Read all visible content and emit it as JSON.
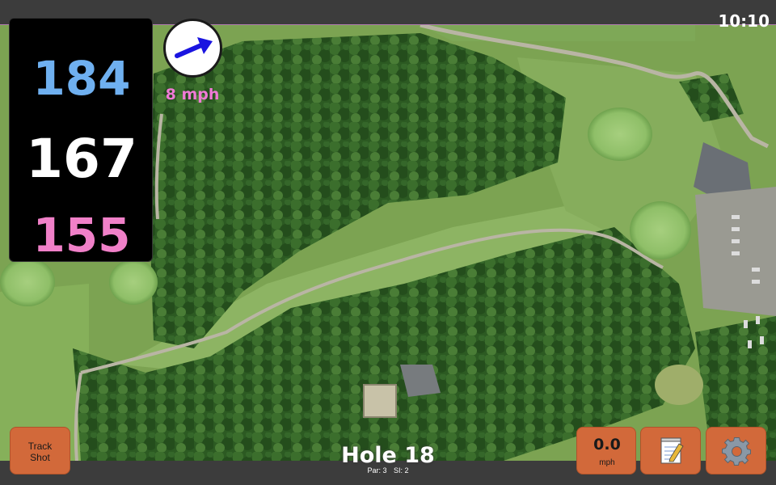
{
  "status": {
    "time": "10:10"
  },
  "yardage": {
    "back": "184",
    "center": "167",
    "front": "155"
  },
  "wind": {
    "speed_label": "8 mph",
    "arrow_color": "#1a14e0"
  },
  "buttons": {
    "track_shot_line1": "Track",
    "track_shot_line2": "Shot",
    "speed_value": "0.0",
    "speed_unit": "mph",
    "notes_icon": "notepad-icon",
    "settings_icon": "gear-icon"
  },
  "hole": {
    "title": "Hole 18",
    "par": "Par: 3",
    "si": "SI: 2"
  },
  "colors": {
    "back_yardage": "#6fb0f0",
    "center_yardage": "#ffffff",
    "front_yardage": "#f080c8",
    "button_bg": "#d2693a",
    "wind_text": "#f07ad6"
  }
}
